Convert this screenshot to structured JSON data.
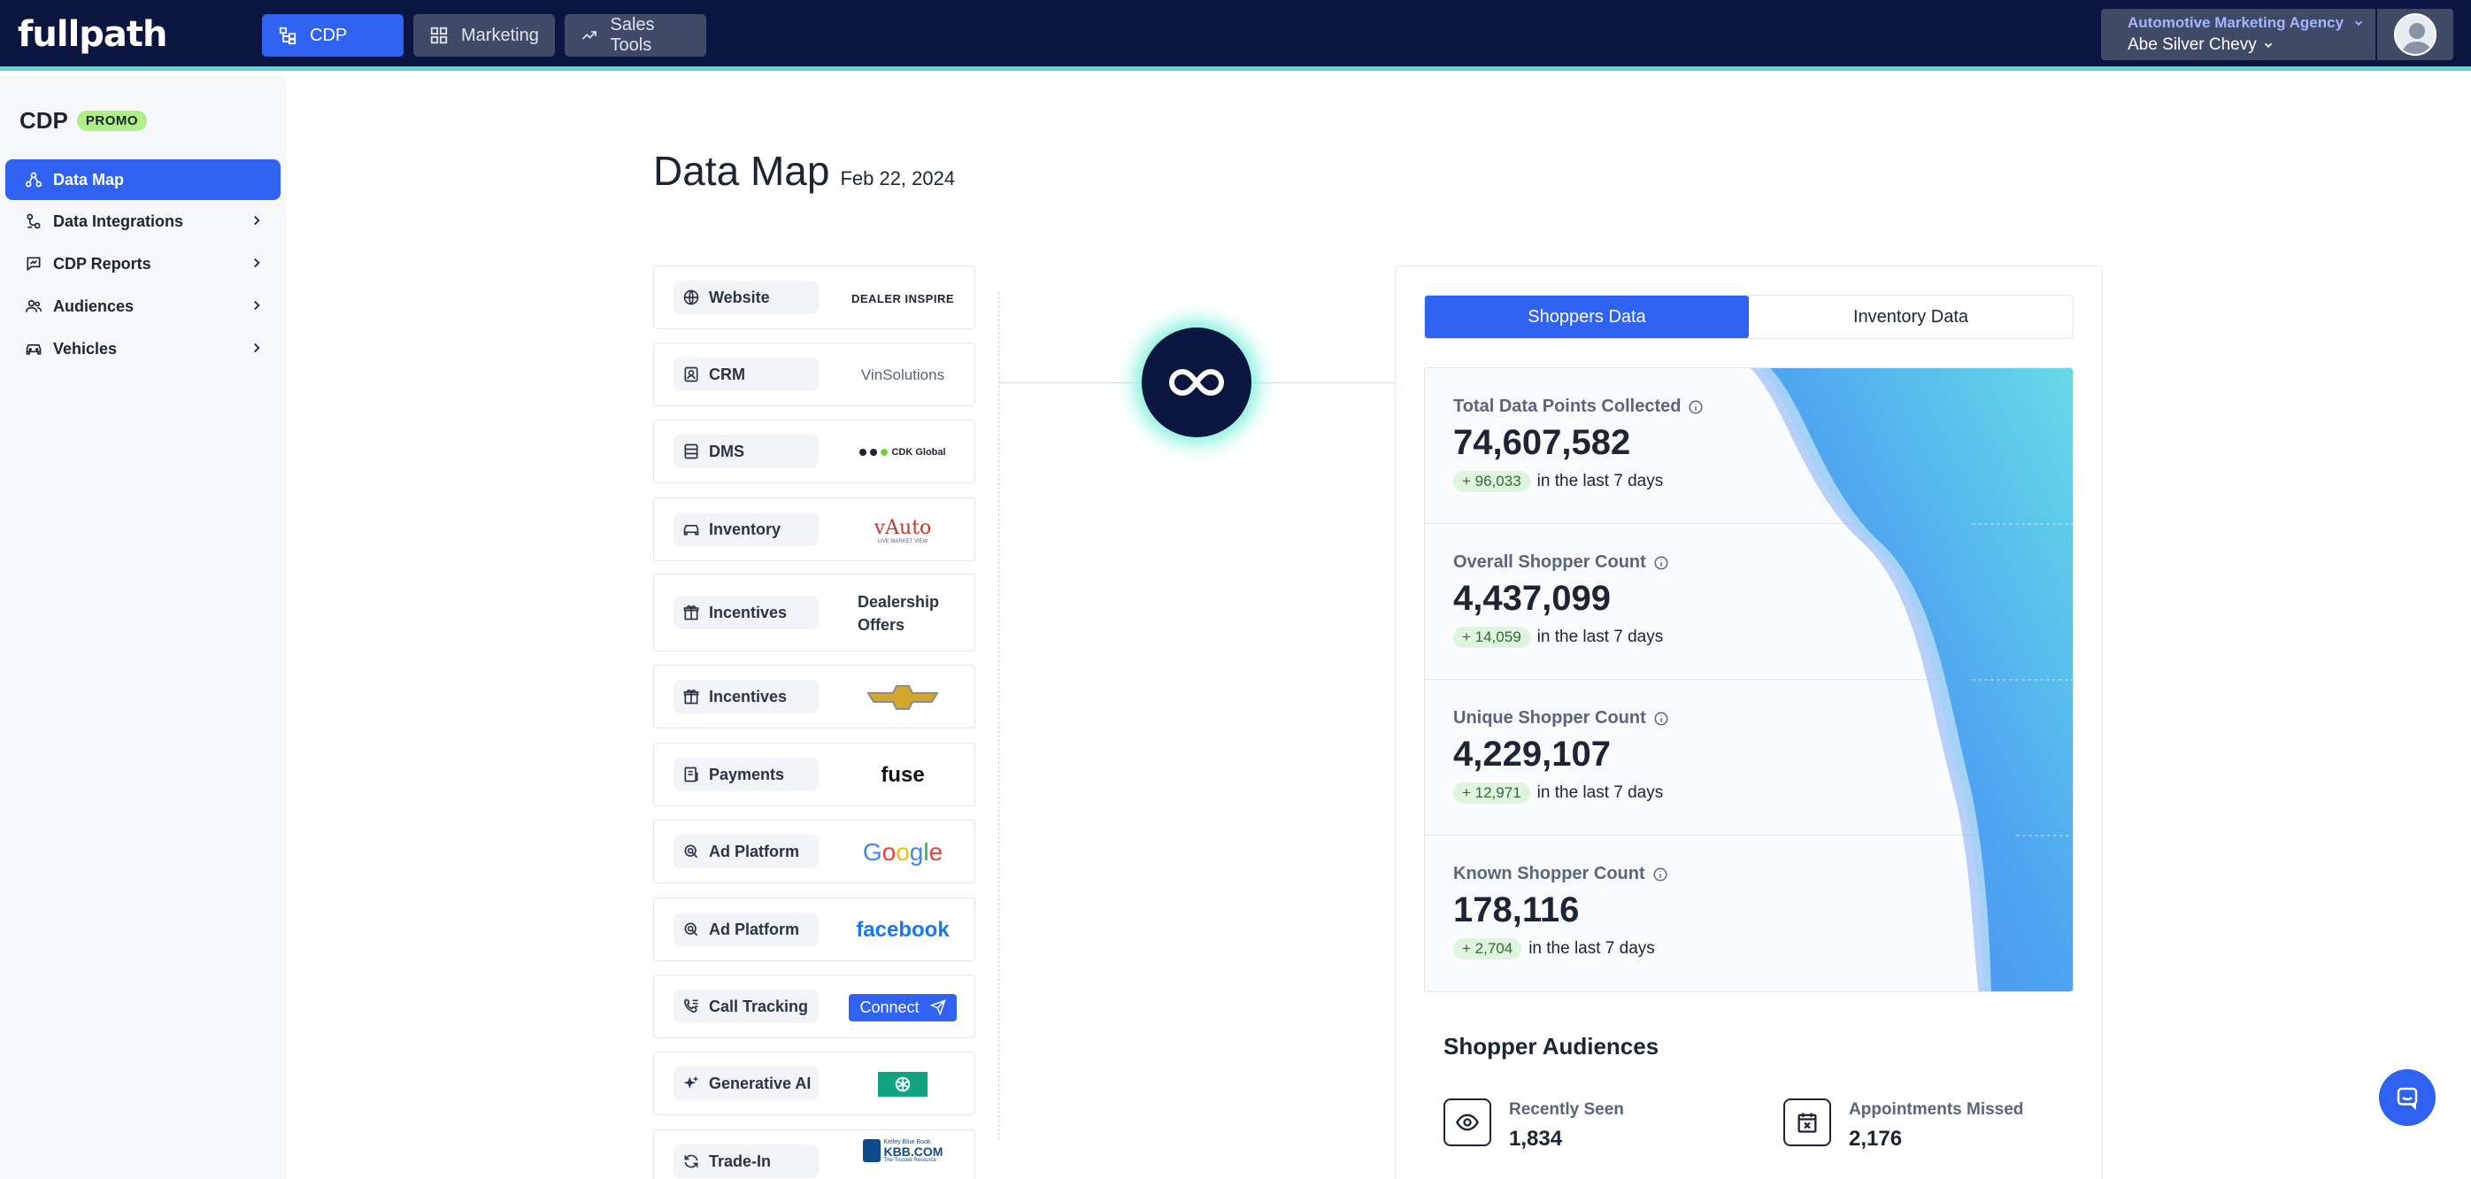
{
  "brand": {
    "logo": "fullpath"
  },
  "nav": {
    "items": [
      {
        "label": "CDP",
        "active": true
      },
      {
        "label": "Marketing",
        "active": false
      },
      {
        "label": "Sales Tools",
        "active": false
      }
    ]
  },
  "account": {
    "agency": "Automotive Marketing Agency",
    "dealer": "Abe Silver Chevy"
  },
  "sidebar": {
    "title": "CDP",
    "badge": "PROMO",
    "items": [
      {
        "label": "Data Map",
        "active": true
      },
      {
        "label": "Data Integrations"
      },
      {
        "label": "CDP Reports"
      },
      {
        "label": "Audiences"
      },
      {
        "label": "Vehicles"
      }
    ]
  },
  "header": {
    "title": "Data Map",
    "date": "Feb 22, 2024"
  },
  "sources": [
    {
      "label": "Website",
      "icon": "globe-icon",
      "logo": "DEALER INSPIRE"
    },
    {
      "label": "CRM",
      "icon": "contact-icon",
      "logo": "VinSolutions"
    },
    {
      "label": "DMS",
      "icon": "database-icon",
      "logo": "CDK Global"
    },
    {
      "label": "Inventory",
      "icon": "car-icon",
      "logo": "vAuto",
      "logo_sub": "LIVE MARKET VIEW"
    },
    {
      "label": "Incentives",
      "icon": "gift-icon",
      "logo": "Dealership Offers"
    },
    {
      "label": "Incentives",
      "icon": "gift-icon",
      "logo": "chevrolet-bowtie"
    },
    {
      "label": "Payments",
      "icon": "receipt-icon",
      "logo": "fuse"
    },
    {
      "label": "Ad Platform",
      "icon": "ad-icon",
      "logo": "Google"
    },
    {
      "label": "Ad Platform",
      "icon": "ad-icon",
      "logo": "facebook"
    },
    {
      "label": "Call Tracking",
      "icon": "phone-icon",
      "logo": "Connect"
    },
    {
      "label": "Generative AI",
      "icon": "sparkle-icon",
      "logo": "openai-logo"
    },
    {
      "label": "Trade-In",
      "icon": "refresh-icon",
      "logo": "KBB.COM",
      "logo_top": "Kelley Blue Book",
      "logo_sub": "The Trusted Resource"
    }
  ],
  "tabs": [
    {
      "label": "Shoppers Data",
      "active": true
    },
    {
      "label": "Inventory Data",
      "active": false
    }
  ],
  "stats": [
    {
      "label": "Total Data Points Collected",
      "value": "74,607,582",
      "delta": "+ 96,033",
      "delta_text": "in the last 7 days"
    },
    {
      "label": "Overall Shopper Count",
      "value": "4,437,099",
      "delta": "+ 14,059",
      "delta_text": "in the last 7 days"
    },
    {
      "label": "Unique Shopper Count",
      "value": "4,229,107",
      "delta": "+ 12,971",
      "delta_text": "in the last 7 days"
    },
    {
      "label": "Known Shopper Count",
      "value": "178,116",
      "delta": "+ 2,704",
      "delta_text": "in the last 7 days"
    }
  ],
  "audiences": {
    "title": "Shopper Audiences",
    "items": [
      {
        "label": "Recently Seen",
        "value": "1,834",
        "icon": "eye-icon"
      },
      {
        "label": "Appointments Missed",
        "value": "2,176",
        "icon": "calendar-x-icon"
      }
    ]
  },
  "colors": {
    "primary": "#2f62f0",
    "navy": "#0b1640",
    "accent": "#5fd9d6"
  }
}
